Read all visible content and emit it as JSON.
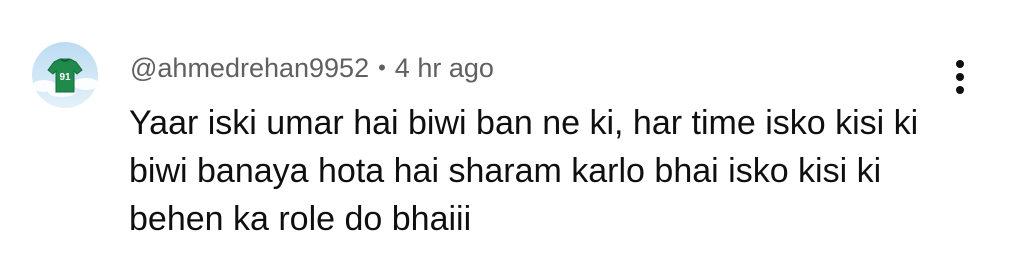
{
  "comment": {
    "author": "@ahmedrehan9952",
    "separator": "•",
    "time": "4 hr ago",
    "text": "Yaar iski umar hai biwi ban ne ki, har time isko kisi ki biwi banaya hota hai sharam karlo bhai isko kisi ki behen ka role do bhaiii",
    "avatar_jersey_number": "91",
    "menu_icon": "more-vertical-icon"
  },
  "colors": {
    "text_primary": "#0f0f0f",
    "text_secondary": "#606060",
    "avatar_sky": "#cfe6f5",
    "avatar_jersey": "#1f8a4c"
  }
}
